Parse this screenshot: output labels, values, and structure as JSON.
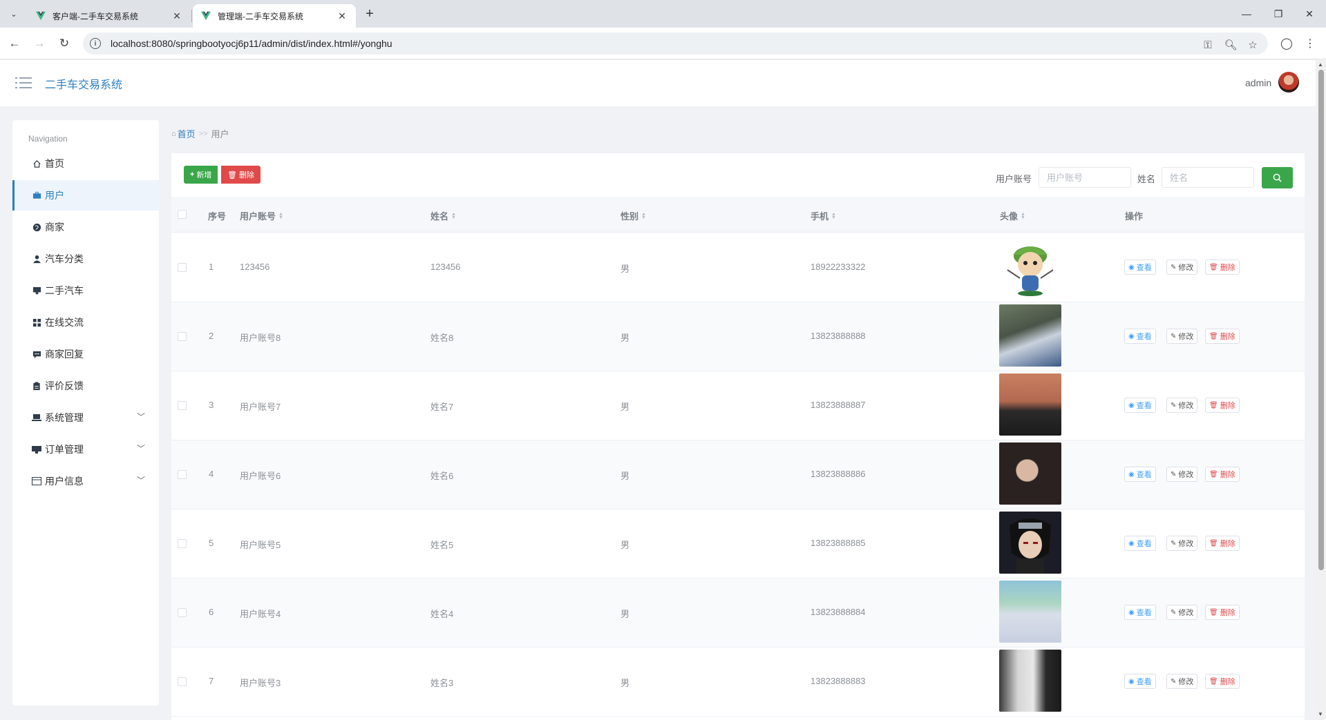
{
  "browser": {
    "tabs": [
      {
        "title": "客户端-二手车交易系统"
      },
      {
        "title": "管理端-二手车交易系统"
      }
    ],
    "url": "localhost:8080/springbootyocj6p11/admin/dist/index.html#/yonghu"
  },
  "header": {
    "app_title": "二手车交易系统",
    "user_name": "admin"
  },
  "sidebar": {
    "nav_title": "Navigation",
    "items": [
      {
        "label": "首页",
        "icon": "home-icon"
      },
      {
        "label": "用户",
        "icon": "briefcase-icon"
      },
      {
        "label": "商家",
        "icon": "globe-icon"
      },
      {
        "label": "汽车分类",
        "icon": "person-icon"
      },
      {
        "label": "二手汽车",
        "icon": "monitor-icon"
      },
      {
        "label": "在线交流",
        "icon": "grid-icon"
      },
      {
        "label": "商家回复",
        "icon": "chat-icon"
      },
      {
        "label": "评价反馈",
        "icon": "clipboard-icon"
      },
      {
        "label": "系统管理",
        "icon": "laptop-icon"
      },
      {
        "label": "订单管理",
        "icon": "desktop-icon"
      },
      {
        "label": "用户信息",
        "icon": "card-icon"
      }
    ]
  },
  "breadcrumb": {
    "home": "首页",
    "separator": ">>",
    "current": "用户"
  },
  "toolbar": {
    "add_label": "新增",
    "delete_label": "删除"
  },
  "search": {
    "account_label": "用户账号",
    "account_placeholder": "用户账号",
    "name_label": "姓名",
    "name_placeholder": "姓名"
  },
  "table": {
    "columns": [
      "序号",
      "用户账号",
      "姓名",
      "性别",
      "手机",
      "头像",
      "操作"
    ],
    "actions": {
      "view": "查看",
      "edit": "修改",
      "remove": "删除"
    },
    "rows": [
      {
        "index": "1",
        "account": "123456",
        "name": "123456",
        "gender": "男",
        "phone": "18922233322"
      },
      {
        "index": "2",
        "account": "用户账号8",
        "name": "姓名8",
        "gender": "男",
        "phone": "13823888888"
      },
      {
        "index": "3",
        "account": "用户账号7",
        "name": "姓名7",
        "gender": "男",
        "phone": "13823888887"
      },
      {
        "index": "4",
        "account": "用户账号6",
        "name": "姓名6",
        "gender": "男",
        "phone": "13823888886"
      },
      {
        "index": "5",
        "account": "用户账号5",
        "name": "姓名5",
        "gender": "男",
        "phone": "13823888885"
      },
      {
        "index": "6",
        "account": "用户账号4",
        "name": "姓名4",
        "gender": "男",
        "phone": "13823888884"
      },
      {
        "index": "7",
        "account": "用户账号3",
        "name": "姓名3",
        "gender": "男",
        "phone": "13823888883"
      }
    ]
  },
  "colors": {
    "accent": "#2d7fc0",
    "add_button": "#3aa64a",
    "delete_button": "#e04a4a",
    "view_action": "#409eff"
  }
}
